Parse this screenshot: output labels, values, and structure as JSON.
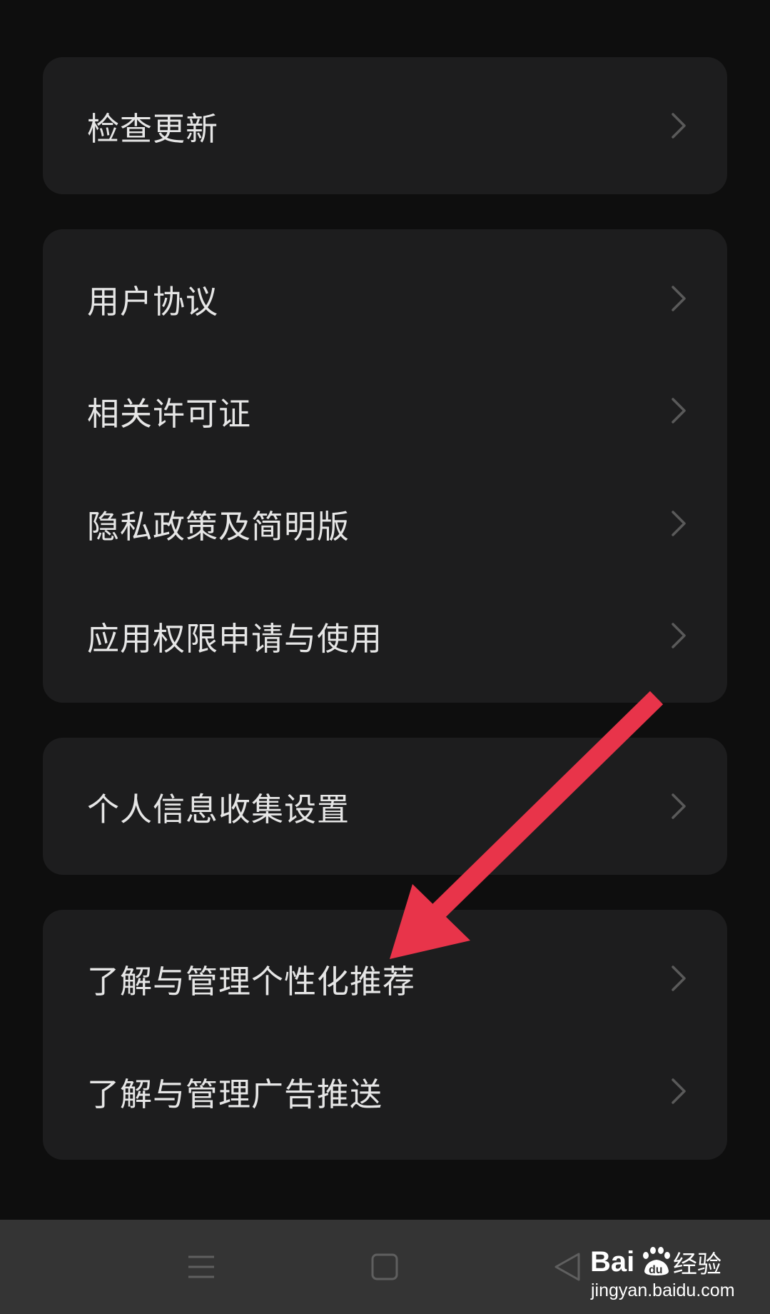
{
  "groups": [
    {
      "items": [
        {
          "label": "检查更新"
        }
      ]
    },
    {
      "items": [
        {
          "label": "用户协议"
        },
        {
          "label": "相关许可证"
        },
        {
          "label": "隐私政策及简明版"
        },
        {
          "label": "应用权限申请与使用"
        }
      ]
    },
    {
      "items": [
        {
          "label": "个人信息收集设置"
        }
      ]
    },
    {
      "items": [
        {
          "label": "了解与管理个性化推荐"
        },
        {
          "label": "了解与管理广告推送"
        }
      ]
    }
  ],
  "icons": {
    "row_chevron": "chevron-right-icon",
    "nav_menu": "menu-lines-icon",
    "nav_home": "home-square-icon",
    "nav_back": "back-triangle-icon"
  },
  "watermark": {
    "brand": "Baidu经验",
    "url": "jingyan.baidu.com"
  },
  "colors": {
    "background": "#0e0e0e",
    "card": "#1d1d1e",
    "text": "#e6e6e6",
    "chevron": "#5a5a5a",
    "navbar": "#343434",
    "annotation_arrow": "#e8344a"
  }
}
